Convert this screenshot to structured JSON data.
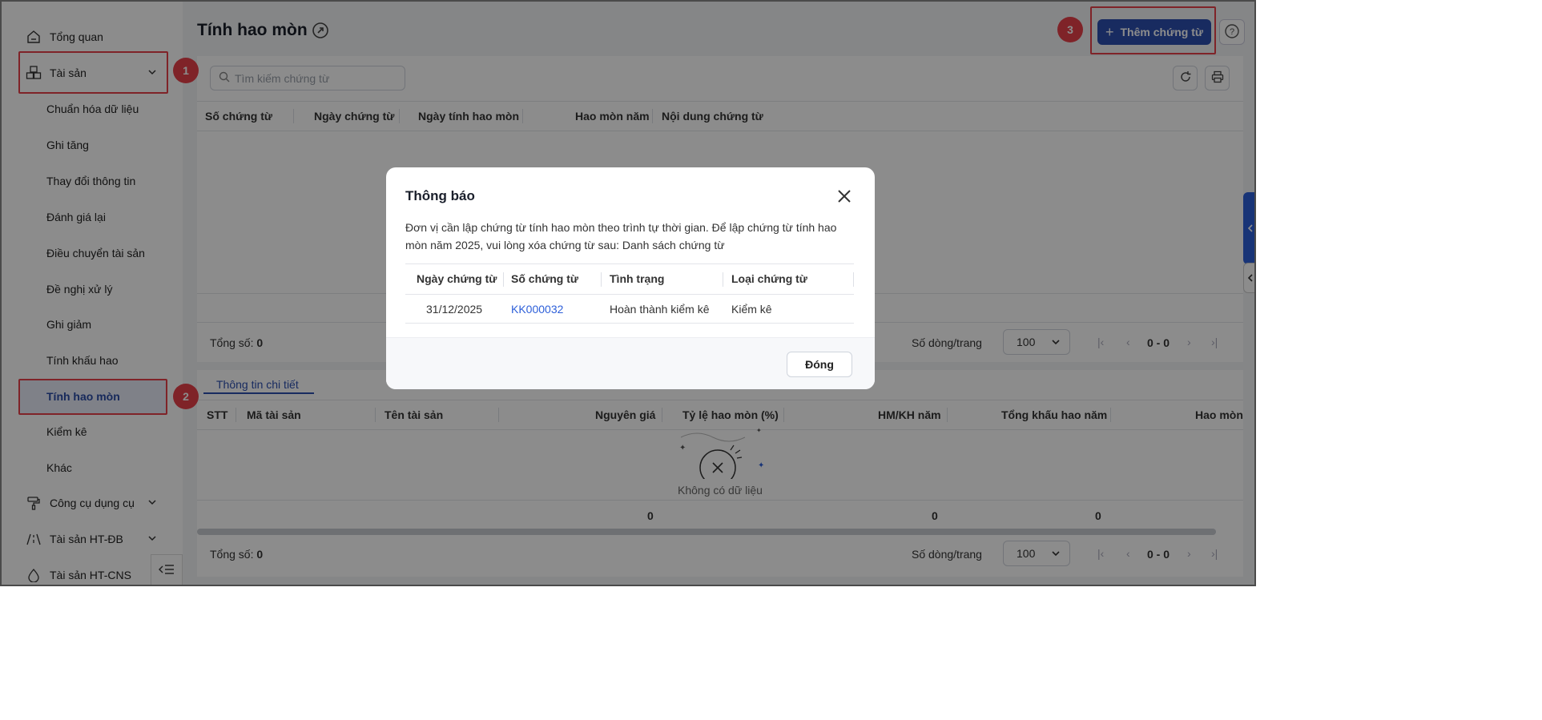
{
  "sidebar": {
    "items": [
      {
        "label": "Tổng quan",
        "icon": "home-icon"
      },
      {
        "label": "Tài sản",
        "icon": "cubes-icon"
      },
      {
        "label": "Công cụ dụng cụ",
        "icon": "paint-roller-icon"
      },
      {
        "label": "Tài sản HT-ĐB",
        "icon": "road-icon"
      },
      {
        "label": "Tài sản HT-CNS",
        "icon": "water-drop-icon"
      }
    ],
    "sub_items": [
      "Chuẩn hóa dữ liệu",
      "Ghi tăng",
      "Thay đổi thông tin",
      "Đánh giá lại",
      "Điều chuyển tài sản",
      "Đề nghị xử lý",
      "Ghi giảm",
      "Tính khấu hao",
      "Tính hao mòn",
      "Kiểm kê",
      "Khác"
    ],
    "active_sub": "Tính hao mòn"
  },
  "badges": [
    "1",
    "2",
    "3"
  ],
  "header": {
    "title": "Tính hao mòn",
    "add_button": "Thêm chứng từ"
  },
  "search": {
    "placeholder": "Tìm kiếm chứng từ"
  },
  "main_table": {
    "columns": [
      "Số chứng từ",
      "Ngày chứng từ",
      "Ngày tính hao mòn",
      "Hao mòn năm",
      "Nội dung chứng từ"
    ],
    "total_label": "Tổng số:",
    "total_value": "0",
    "rows_per_page_label": "Số dòng/trang",
    "rows_per_page": "100",
    "page_range": "0 - 0"
  },
  "detail": {
    "tab": "Thông tin chi tiết",
    "columns": [
      "STT",
      "Mã tài sản",
      "Tên tài sản",
      "Nguyên giá",
      "Tỷ lệ hao mòn (%)",
      "HM/KH năm",
      "Tổng khấu hao năm",
      "Hao mòn"
    ],
    "empty_text": "Không có dữ liệu",
    "sums": [
      "0",
      "0",
      "0"
    ],
    "total_label": "Tổng số:",
    "total_value": "0",
    "rows_per_page_label": "Số dòng/trang",
    "rows_per_page": "100",
    "page_range": "0 - 0"
  },
  "modal": {
    "title": "Thông báo",
    "message": "Đơn vị cần lập chứng từ tính hao mòn theo trình tự thời gian. Để lập chứng từ tính hao mòn năm 2025, vui lòng xóa chứng từ sau: Danh sách chứng từ",
    "columns": [
      "Ngày chứng từ",
      "Số chứng từ",
      "Tình trạng",
      "Loại chứng từ"
    ],
    "rows": [
      {
        "date": "31/12/2025",
        "number": "KK000032",
        "status": "Hoàn thành kiểm kê",
        "type": "Kiểm kê"
      }
    ],
    "close_button": "Đóng"
  },
  "colors": {
    "primary": "#2d4fb0",
    "highlight": "#e8404a",
    "link": "#2d5fd9"
  }
}
